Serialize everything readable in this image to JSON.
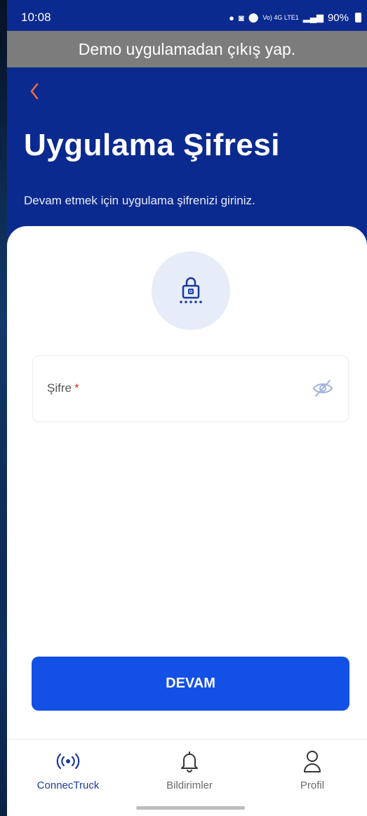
{
  "status_bar": {
    "time": "10:08",
    "battery": "90%",
    "signal_text": "Vo) 4G LTE1"
  },
  "demo_banner": {
    "text": "Demo uygulamadan çıkış yap."
  },
  "header": {
    "back_icon": "chevron-left-icon",
    "title": "Uygulama Şifresi",
    "subtitle": "Devam etmek için uygulama şifrenizi giriniz."
  },
  "lock": {
    "icon": "lock-password-icon"
  },
  "password_field": {
    "label": "Şifre",
    "required_mark": "*",
    "visibility_icon": "eye-off-icon"
  },
  "submit_button": {
    "label": "DEVAM"
  },
  "bottom_nav": {
    "items": [
      {
        "label": "ConnecTruck",
        "icon": "radio-signal-icon",
        "active": true
      },
      {
        "label": "Bildirimler",
        "icon": "bell-icon",
        "active": false
      },
      {
        "label": "Profil",
        "icon": "user-icon",
        "active": false
      }
    ]
  },
  "colors": {
    "primary": "#0b2a8f",
    "button": "#1350e6",
    "accent_back": "#ff6a3d",
    "banner": "#7c7c7c"
  }
}
